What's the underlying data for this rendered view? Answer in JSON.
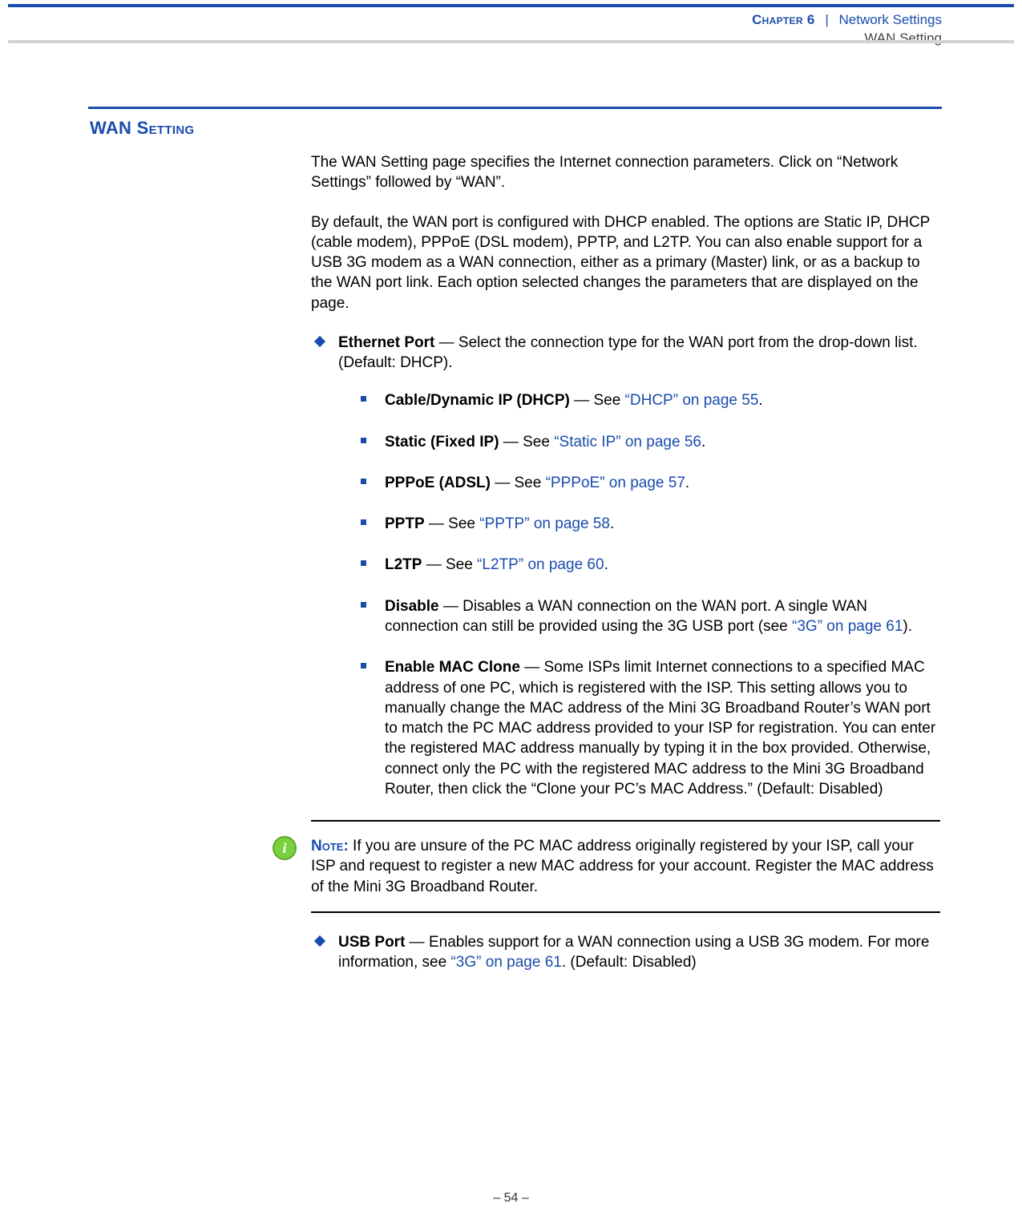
{
  "header": {
    "chapter_label": "Chapter 6",
    "separator": "|",
    "chapter_section": "Network Settings",
    "subsection": "WAN Setting"
  },
  "section_heading_1": "WAN S",
  "section_heading_2": "etting",
  "intro_p1": "The WAN Setting page specifies the Internet connection parameters. Click on “Network Settings” followed by “WAN”.",
  "intro_p2": "By default, the WAN port is configured with DHCP enabled. The options are Static IP, DHCP (cable modem), PPPoE (DSL modem), PPTP, and L2TP. You can also enable support for a USB 3G modem as a WAN connection, either as a primary (Master) link, or as a backup to the WAN port link. Each option selected changes the parameters that are displayed on the page.",
  "ethernet_port": {
    "label": "Ethernet Port",
    "text": " — Select the connection type for the WAN port from the drop-down list. (Default: DHCP)."
  },
  "items": {
    "dhcp": {
      "label": "Cable/Dynamic IP (DHCP)",
      "pre": " — See ",
      "link": "“DHCP” on page 55",
      "post": "."
    },
    "static": {
      "label": "Static (Fixed IP)",
      "pre": " — See ",
      "link": "“Static IP” on page 56",
      "post": "."
    },
    "pppoe": {
      "label": "PPPoE (ADSL)",
      "pre": " — See ",
      "link": "“PPPoE” on page 57",
      "post": "."
    },
    "pptp": {
      "label": "PPTP",
      "pre": " — See ",
      "link": "“PPTP” on page 58",
      "post": "."
    },
    "l2tp": {
      "label": "L2TP",
      "pre": " — See ",
      "link": "“L2TP” on page 60",
      "post": "."
    },
    "disable": {
      "label": "Disable",
      "pre": " — Disables a WAN connection on the WAN port. A single WAN connection can still be provided using the 3G USB port (see ",
      "link": "“3G” on page 61",
      "post": ")."
    },
    "mac_clone": {
      "label": "Enable MAC Clone",
      "text": " — Some ISPs limit Internet connections to a specified MAC address of one PC, which is registered with the ISP. This setting allows you to manually change the MAC address of the Mini 3G Broadband Router’s WAN port to match the PC MAC address provided to your ISP for registration. You can enter the registered MAC address manually by typing it in the box provided. Otherwise, connect only the PC with the registered MAC address to the Mini 3G Broadband Router, then click the “Clone your PC’s MAC Address.” (Default: Disabled)"
    }
  },
  "note": {
    "label": "Note:",
    "text": " If you are unsure of the PC MAC address originally registered by your ISP, call your ISP and request to register a new MAC address for your account. Register the MAC address of the Mini 3G Broadband Router."
  },
  "usb_port": {
    "label": "USB Port",
    "pre": " — Enables support for a WAN connection using a USB 3G modem. For more information, see ",
    "link": "“3G” on page 61",
    "post": ". (Default: Disabled)"
  },
  "footer": "–  54  –"
}
